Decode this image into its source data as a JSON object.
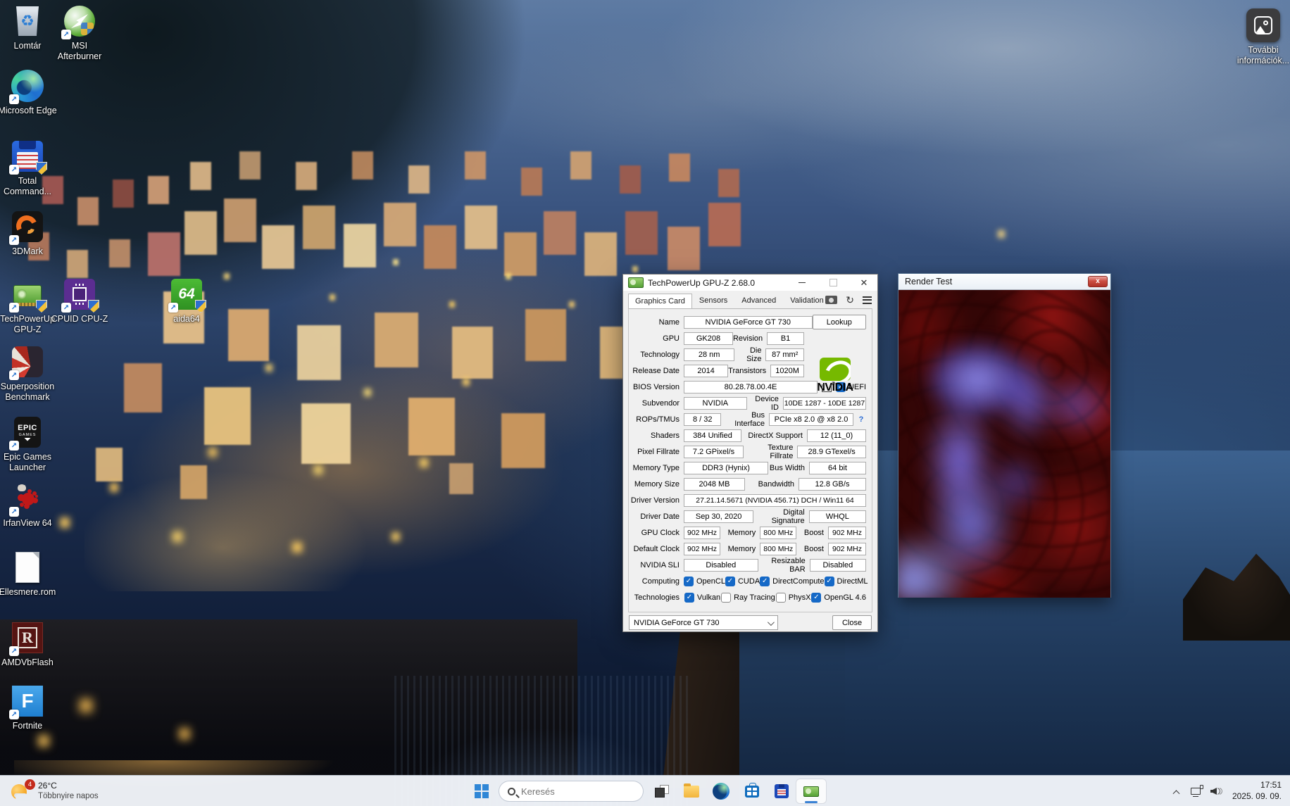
{
  "desktop": {
    "icons": {
      "recycle": {
        "label": "Lomtár"
      },
      "msi": {
        "label": "MSI Afterburner"
      },
      "edge": {
        "label": "Microsoft Edge"
      },
      "totalcmd": {
        "label": "Total Command..."
      },
      "threedmark": {
        "label": "3DMark"
      },
      "gpuz": {
        "label": "TechPowerUp GPU-Z"
      },
      "cpuz": {
        "label": "CPUID CPU-Z"
      },
      "aida64": {
        "label": "aida64"
      },
      "superposition": {
        "label": "Superposition Benchmark"
      },
      "epic": {
        "label": "Epic Games Launcher"
      },
      "irfanview": {
        "label": "IrfanView 64"
      },
      "ellesmere": {
        "label": "Ellesmere.rom"
      },
      "amdvbflash": {
        "label": "AMDVbFlash"
      },
      "fortnite": {
        "label": "Fortnite"
      },
      "info_tile": {
        "label": "További információk..."
      }
    },
    "epic_logo": {
      "line1": "EPIC",
      "line2": "GAMES"
    },
    "aida_logo": "64",
    "amdvb_logo": "R",
    "fortnite_logo": "F"
  },
  "gpuz": {
    "title": "TechPowerUp GPU-Z 2.68.0",
    "tabs": [
      "Graphics Card",
      "Sensors",
      "Advanced",
      "Validation"
    ],
    "nvidia_logo_text": "NVIDIA",
    "fields": {
      "name_label": "Name",
      "name": "NVIDIA GeForce GT 730",
      "lookup": "Lookup",
      "gpu_label": "GPU",
      "gpu": "GK208",
      "revision_label": "Revision",
      "revision": "B1",
      "technology_label": "Technology",
      "technology": "28 nm",
      "die_size_label": "Die Size",
      "die_size": "87 mm²",
      "release_date_label": "Release Date",
      "release_date": "2014",
      "transistors_label": "Transistors",
      "transistors": "1020M",
      "bios_label": "BIOS Version",
      "bios": "80.28.78.00.4E",
      "uefi_label": "UEFI",
      "subvendor_label": "Subvendor",
      "subvendor": "NVIDIA",
      "device_id_label": "Device ID",
      "device_id": "10DE 1287 - 10DE 1287",
      "rops_label": "ROPs/TMUs",
      "rops": "8 / 32",
      "bus_label": "Bus Interface",
      "bus": "PCIe x8 2.0 @ x8 2.0",
      "bus_help": "?",
      "shaders_label": "Shaders",
      "shaders": "384 Unified",
      "directx_label": "DirectX Support",
      "directx": "12 (11_0)",
      "pixel_label": "Pixel Fillrate",
      "pixel": "7.2 GPixel/s",
      "texture_label": "Texture Fillrate",
      "texture": "28.9 GTexel/s",
      "memtype_label": "Memory Type",
      "memtype": "DDR3 (Hynix)",
      "buswidth_label": "Bus Width",
      "buswidth": "64 bit",
      "memsize_label": "Memory Size",
      "memsize": "2048 MB",
      "bandwidth_label": "Bandwidth",
      "bandwidth": "12.8 GB/s",
      "driver_label": "Driver Version",
      "driver": "27.21.14.5671 (NVIDIA 456.71) DCH / Win11 64",
      "driverdate_label": "Driver Date",
      "driverdate": "Sep 30, 2020",
      "digsig_label": "Digital Signature",
      "digsig": "WHQL",
      "gpuclock_label": "GPU Clock",
      "gpuclock": "902 MHz",
      "mem1_label": "Memory",
      "mem1": "800 MHz",
      "boost1_label": "Boost",
      "boost1": "902 MHz",
      "defclock_label": "Default Clock",
      "defclock": "902 MHz",
      "mem2_label": "Memory",
      "mem2": "800 MHz",
      "boost2_label": "Boost",
      "boost2": "902 MHz",
      "sli_label": "NVIDIA SLI",
      "sli": "Disabled",
      "rebar_label": "Resizable BAR",
      "rebar": "Disabled",
      "computing_label": "Computing",
      "technologies_label": "Technologies"
    },
    "checks": {
      "uefi": {
        "on": true
      },
      "opencl": {
        "label": "OpenCL",
        "on": true
      },
      "cuda": {
        "label": "CUDA",
        "on": true
      },
      "directcompute": {
        "label": "DirectCompute",
        "on": true
      },
      "directml": {
        "label": "DirectML",
        "on": true
      },
      "vulkan": {
        "label": "Vulkan",
        "on": true
      },
      "raytracing": {
        "label": "Ray Tracing",
        "on": false
      },
      "physx": {
        "label": "PhysX",
        "on": false
      },
      "opengl": {
        "label": "OpenGL 4.6",
        "on": true
      }
    },
    "card_select": "NVIDIA GeForce GT 730",
    "close": "Close"
  },
  "render_test": {
    "title": "Render Test",
    "close": "x"
  },
  "taskbar": {
    "weather": {
      "temp": "26°C",
      "condition": "Többnyire napos",
      "badge": "4"
    },
    "search_placeholder": "Keresés",
    "clock": {
      "time": "17:51",
      "date": "2025. 09. 09."
    }
  },
  "colors": {
    "accent": "#2f86d6",
    "check_blue": "#1569c7",
    "nvidia_green": "#76b900",
    "render_close_red": "#c8423a"
  }
}
